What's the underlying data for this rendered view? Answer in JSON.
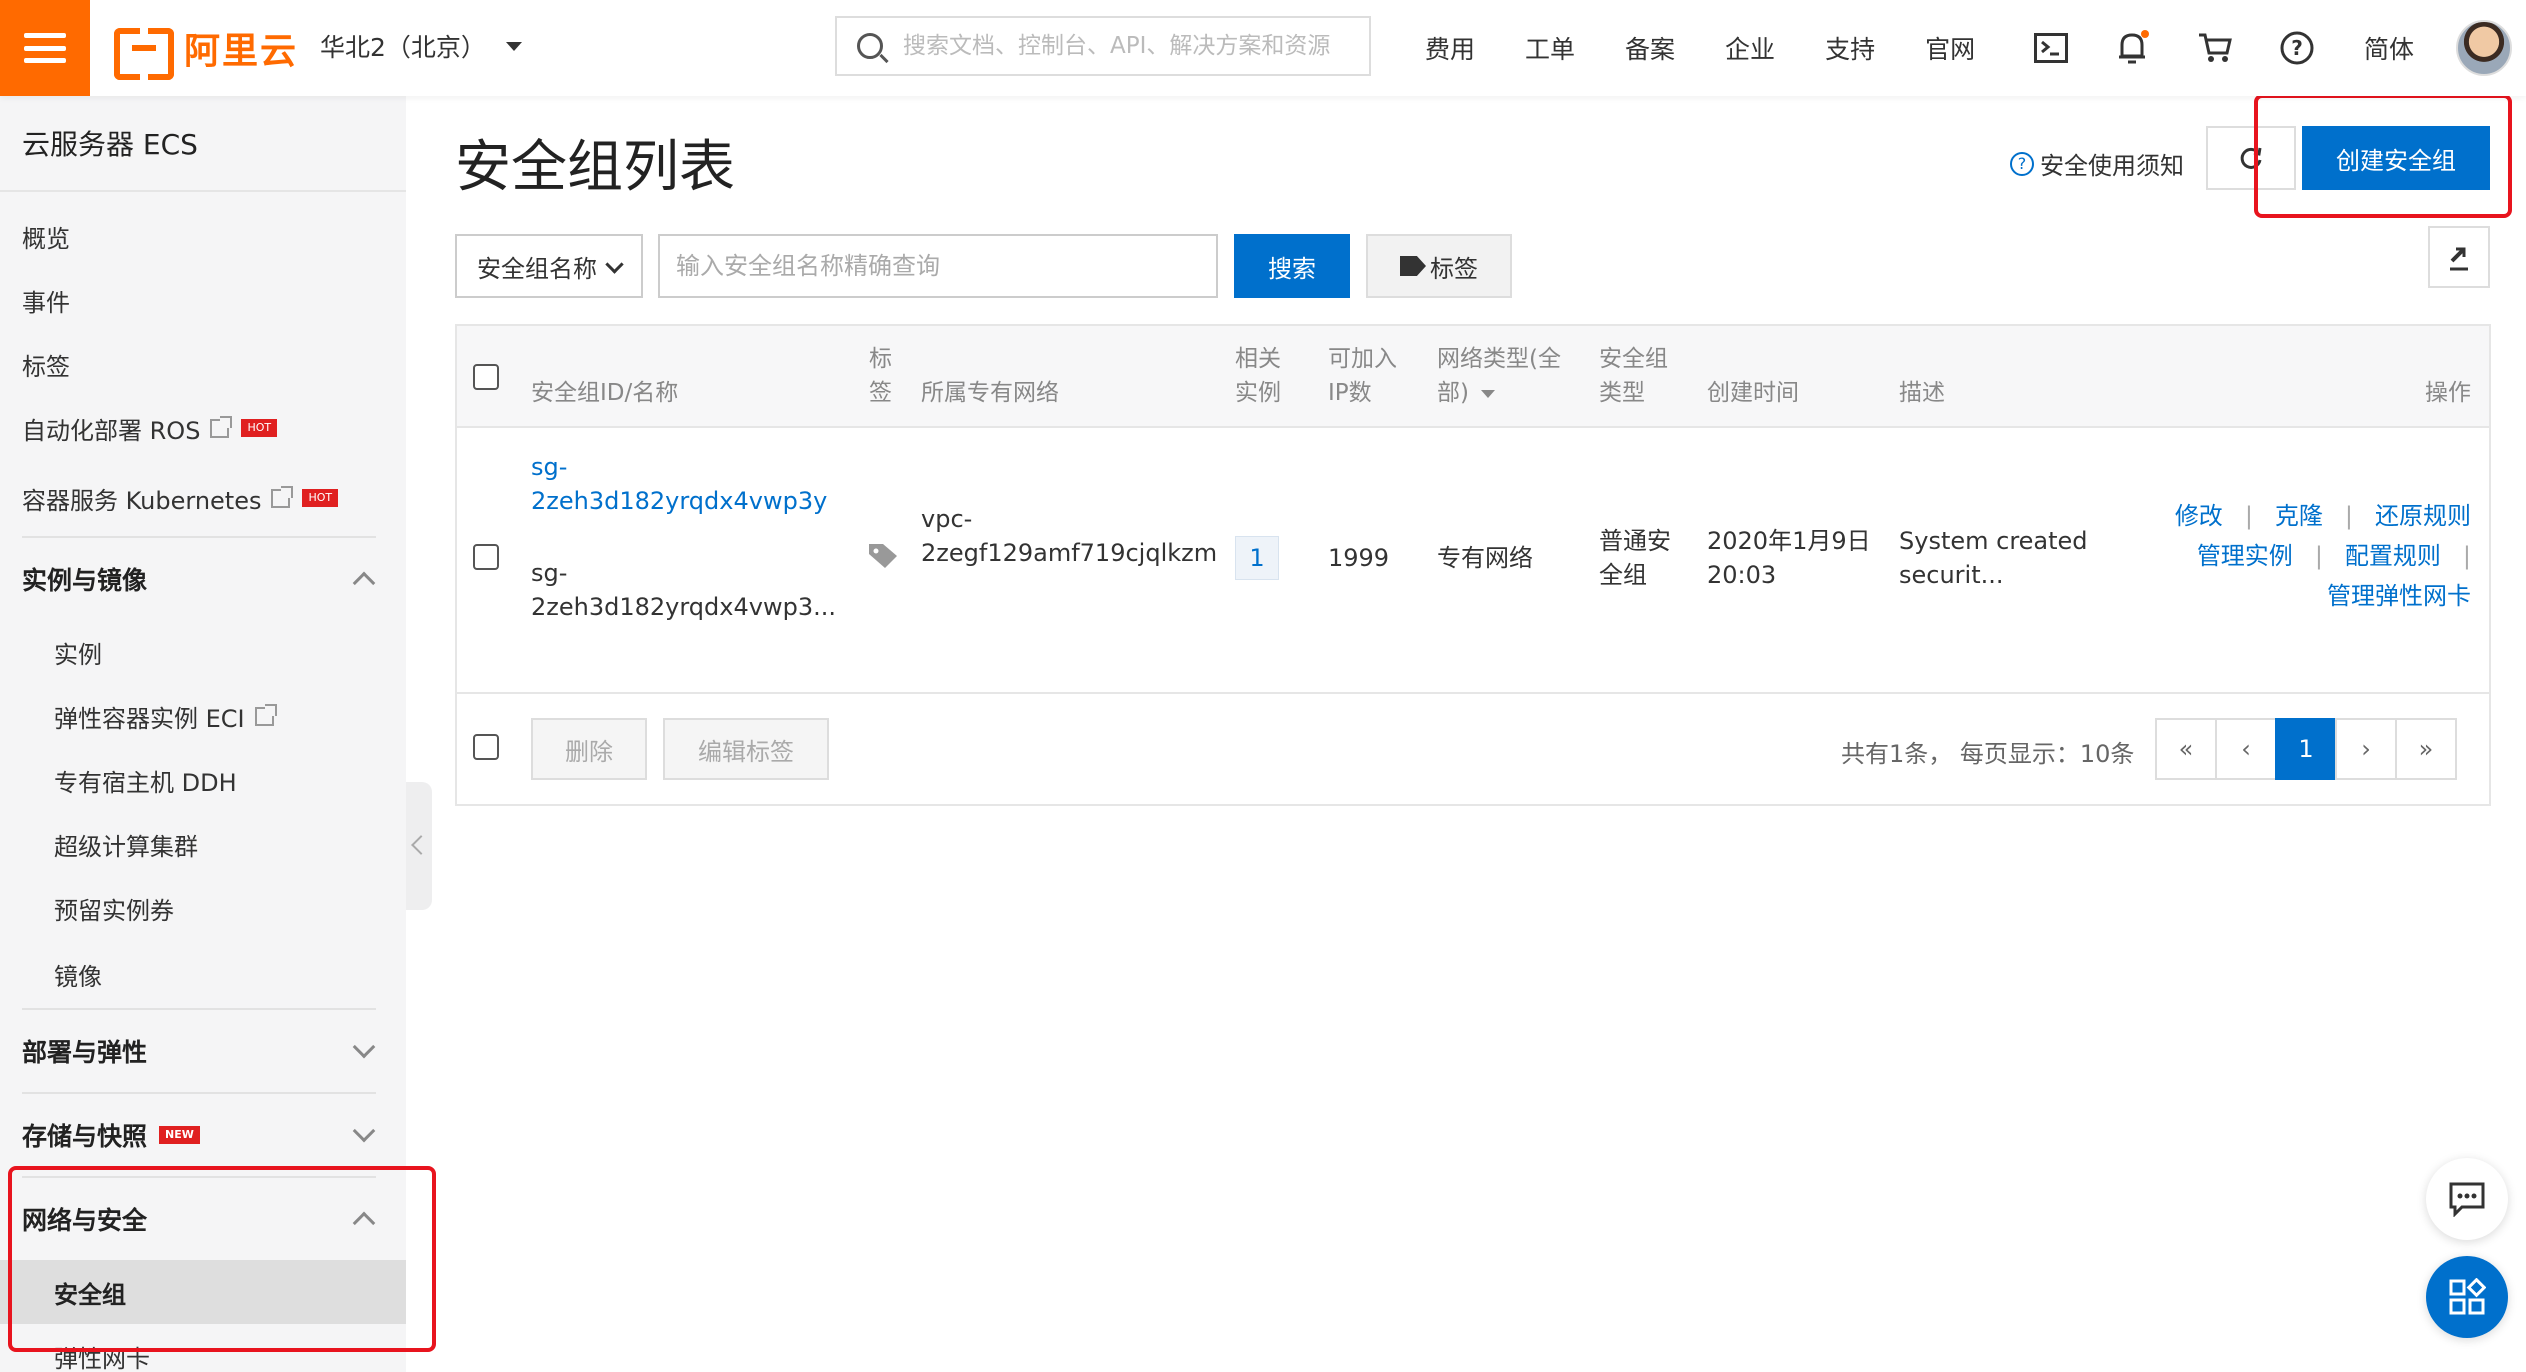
{
  "header": {
    "brand": "阿里云",
    "region": "华北2（北京）",
    "search_placeholder": "搜索文档、控制台、API、解决方案和资源",
    "nav": [
      "费用",
      "工单",
      "备案",
      "企业",
      "支持",
      "官网"
    ],
    "icons": [
      "terminal-icon",
      "bell-icon",
      "cart-icon",
      "help-icon"
    ],
    "lang": "简体",
    "accent": "#ff6a00"
  },
  "sidebar": {
    "title": "云服务器 ECS",
    "top_items": [
      {
        "label": "概览"
      },
      {
        "label": "事件"
      },
      {
        "label": "标签"
      },
      {
        "label": "自动化部署 ROS",
        "badge": "HOT"
      },
      {
        "label": "容器服务 Kubernetes",
        "badge": "HOT"
      }
    ],
    "group_instances": "实例与镜像",
    "instance_items": [
      "实例",
      "弹性容器实例 ECI",
      "专有宿主机 DDH",
      "超级计算集群",
      "预留实例券",
      "镜像"
    ],
    "group_deploy": "部署与弹性",
    "group_storage": "存储与快照",
    "storage_badge": "NEW",
    "group_network": "网络与安全",
    "network_items": [
      "安全组",
      "弹性网卡"
    ],
    "active_item": "安全组"
  },
  "main": {
    "title": "安全组列表",
    "notice": "安全使用须知",
    "create_button": "创建安全组",
    "filter_select": "安全组名称",
    "query_placeholder": "输入安全组名称精确查询",
    "search_button": "搜索",
    "tag_button": "标签",
    "primary_color": "#0070cc",
    "highlight_color": "#e8141e"
  },
  "table": {
    "headers": {
      "id_name": "安全组ID/名称",
      "tag_1": "标",
      "tag_2": "签",
      "vpc": "所属专有网络",
      "inst_1": "相关",
      "inst_2": "实例",
      "ip_1": "可加入",
      "ip_2": "IP数",
      "nettype_1": "网络类型(全",
      "nettype_2": "部)",
      "sgtype_1": "安全组",
      "sgtype_2": "类型",
      "created": "创建时间",
      "desc": "描述",
      "ops": "操作"
    },
    "row": {
      "id_1": "sg-",
      "id_2": "2zeh3d182yrqdx4vwp3y",
      "name_1": "sg-",
      "name_2": "2zeh3d182yrqdx4vwp3...",
      "vpc_1": "vpc-",
      "vpc_2": "2zegf129amf719cjqlkzm",
      "instances": "1",
      "ip_count": "1999",
      "net_type": "专有网络",
      "sg_type_1": "普通安",
      "sg_type_2": "全组",
      "created_1": "2020年1月9日",
      "created_2": "20:03",
      "desc_1": "System created",
      "desc_2": "securit...",
      "ops_1": [
        "修改",
        "克隆",
        "还原规则"
      ],
      "ops_2": [
        "管理实例",
        "配置规则"
      ],
      "ops_3": "管理弹性网卡"
    },
    "footer": {
      "delete": "删除",
      "edit_tags": "编辑标签",
      "summary": "共有1条，  每页显示：10条",
      "pages": [
        "«",
        "‹",
        "1",
        "›",
        "»"
      ],
      "current_page": "1"
    }
  }
}
